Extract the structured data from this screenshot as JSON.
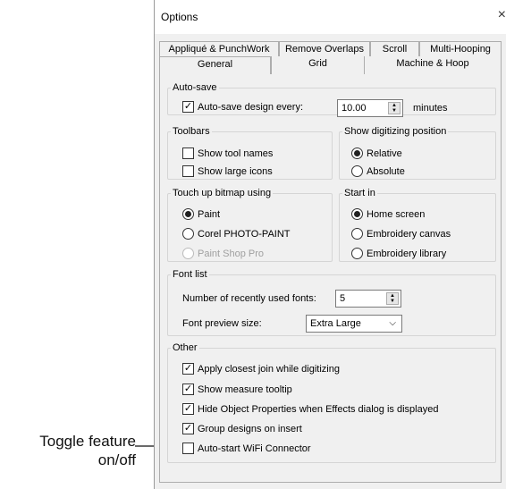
{
  "window": {
    "title": "Options",
    "close": "×"
  },
  "tabs_row1": [
    "Appliqué & PunchWork",
    "Remove Overlaps",
    "Scroll",
    "Multi-Hooping"
  ],
  "tabs_row2": [
    "General",
    "Grid",
    "Machine & Hoop"
  ],
  "active_tab": "General",
  "autosave": {
    "legend": "Auto-save",
    "checkbox_label": "Auto-save design every:",
    "checked": true,
    "interval_value": "10.00",
    "unit": "minutes"
  },
  "toolbars": {
    "legend": "Toolbars",
    "show_tool_names": {
      "label": "Show tool names",
      "checked": false
    },
    "show_large_icons": {
      "label": "Show large icons",
      "checked": false
    }
  },
  "digitizing_position": {
    "legend": "Show digitizing position",
    "options": [
      "Relative",
      "Absolute"
    ],
    "selected": "Relative"
  },
  "touch_up": {
    "legend": "Touch up bitmap using",
    "options": [
      "Paint",
      "Corel PHOTO-PAINT",
      "Paint Shop Pro"
    ],
    "selected": "Paint",
    "disabled": "Paint Shop Pro"
  },
  "start_in": {
    "legend": "Start in",
    "options": [
      "Home screen",
      "Embroidery canvas",
      "Embroidery library"
    ],
    "selected": "Home screen"
  },
  "font_list": {
    "legend": "Font list",
    "recent_label": "Number of recently used fonts:",
    "recent_value": "5",
    "preview_label": "Font preview size:",
    "preview_value": "Extra Large"
  },
  "other": {
    "legend": "Other",
    "items": [
      {
        "label": "Apply closest join while digitizing",
        "checked": true
      },
      {
        "label": "Show measure tooltip",
        "checked": true
      },
      {
        "label": "Hide Object Properties when Effects dialog is displayed",
        "checked": true
      },
      {
        "label": "Group designs on insert",
        "checked": true
      },
      {
        "label": "Auto-start WiFi Connector",
        "checked": false
      }
    ]
  },
  "annotation": {
    "line1": "Toggle feature",
    "line2": "on/off"
  }
}
